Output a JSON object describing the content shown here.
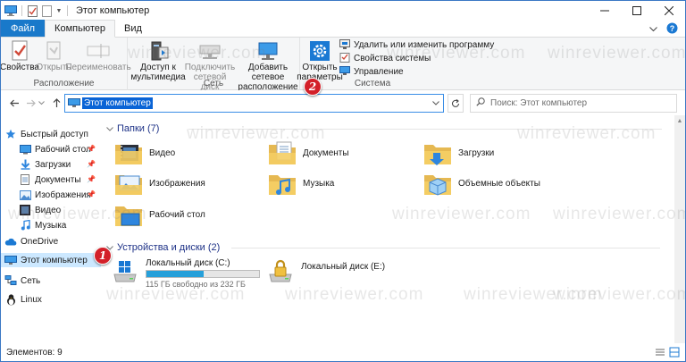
{
  "window": {
    "title": "Этот компьютер"
  },
  "tabs": [
    {
      "label": "Файл"
    },
    {
      "label": "Компьютер"
    },
    {
      "label": "Вид"
    }
  ],
  "ribbon": {
    "groups": {
      "location": "Расположение",
      "network": "Сеть",
      "system": "Система"
    },
    "buttons": {
      "properties": "Свойства",
      "open": "Открыть",
      "rename": "Переименовать",
      "media_access": "Доступ к мультимедиа",
      "map_drive": "Подключить сетевой диск",
      "add_location": "Добавить сетевое расположение",
      "open_settings": "Открыть параметры",
      "uninstall": "Удалить или изменить программу",
      "system_props": "Свойства системы",
      "manage": "Управление"
    }
  },
  "address": {
    "value": "Этот компьютер",
    "search_placeholder": "Поиск: Этот компьютер"
  },
  "nav": {
    "quick_access": "Быстрый доступ",
    "items": [
      {
        "label": "Рабочий стол",
        "pinned": true
      },
      {
        "label": "Загрузки",
        "pinned": true
      },
      {
        "label": "Документы",
        "pinned": true
      },
      {
        "label": "Изображения",
        "pinned": true
      },
      {
        "label": "Видео",
        "pinned": false
      },
      {
        "label": "Музыка",
        "pinned": false
      }
    ],
    "onedrive": "OneDrive",
    "this_pc": "Этот компьютер",
    "network": "Сеть",
    "linux": "Linux"
  },
  "content": {
    "folders_header": "Папки (7)",
    "folders": [
      {
        "label": "Видео",
        "icon": "video-folder-icon"
      },
      {
        "label": "Документы",
        "icon": "documents-folder-icon"
      },
      {
        "label": "Загрузки",
        "icon": "downloads-folder-icon"
      },
      {
        "label": "Изображения",
        "icon": "pictures-folder-icon"
      },
      {
        "label": "Музыка",
        "icon": "music-folder-icon"
      },
      {
        "label": "Объемные объекты",
        "icon": "3d-objects-folder-icon"
      },
      {
        "label": "Рабочий стол",
        "icon": "desktop-folder-icon"
      }
    ],
    "drives_header": "Устройства и диски (2)",
    "drives": [
      {
        "label": "Локальный диск (C:)",
        "free": "115 ГБ свободно из 232 ГБ",
        "used_fraction": 0.504
      },
      {
        "label": "Локальный диск (E:)"
      }
    ]
  },
  "status": {
    "items": "Элементов: 9"
  },
  "annotations": {
    "badge1": "1",
    "badge2": "2"
  },
  "watermark": "winreviewer.com",
  "colors": {
    "accent": "#1979ca",
    "selection": "#cce8ff",
    "badge": "#d32029"
  }
}
